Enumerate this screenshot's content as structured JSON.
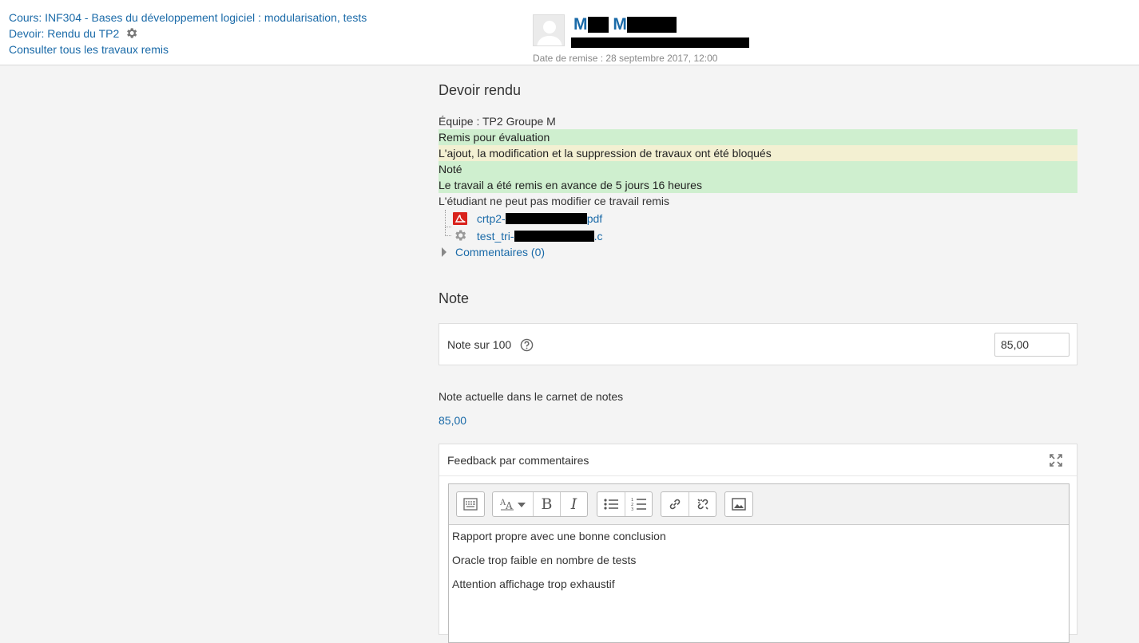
{
  "breadcrumbs": {
    "course": "Cours: INF304 - Bases du développement logiciel : modularisation, tests",
    "assignment": "Devoir: Rendu du TP2",
    "view_all": "Consulter tous les travaux remis"
  },
  "user": {
    "name_initial_1": "M",
    "name_initial_2": "M",
    "due_date": "Date de remise : 28 septembre 2017, 12:00"
  },
  "submission": {
    "heading": "Devoir rendu",
    "team": "Équipe : TP2 Groupe M",
    "statuses": [
      {
        "text": "Remis pour évaluation",
        "tone": "green"
      },
      {
        "text": "L'ajout, la modification et la suppression de travaux ont été bloqués",
        "tone": "yellow"
      },
      {
        "text": "Noté",
        "tone": "green"
      },
      {
        "text": "Le travail a été remis en avance de 5 jours 16 heures",
        "tone": "green"
      }
    ],
    "cannot_modify": "L'étudiant ne peut pas modifier ce travail remis",
    "files": [
      {
        "prefix": "crtp2-",
        "suffix": "pdf",
        "icon": "pdf-icon"
      },
      {
        "prefix": "test_tri-",
        "suffix": ".c",
        "icon": "source-file-gear-icon"
      }
    ],
    "comments_link": "Commentaires (0)"
  },
  "grade": {
    "heading": "Note",
    "label": "Note sur 100",
    "value": "85,00",
    "current_label": "Note actuelle dans le carnet de notes",
    "current_value": "85,00"
  },
  "feedback": {
    "title": "Feedback par commentaires",
    "lines": [
      "Rapport propre avec une bonne conclusion",
      "Oracle trop faible en nombre de tests",
      "Attention affichage trop exhaustif"
    ]
  },
  "colors": {
    "link": "#1a6aa8",
    "status_green": "#cfefcf",
    "status_yellow": "#f3f0d2",
    "page_bg": "#f4f4f4"
  }
}
